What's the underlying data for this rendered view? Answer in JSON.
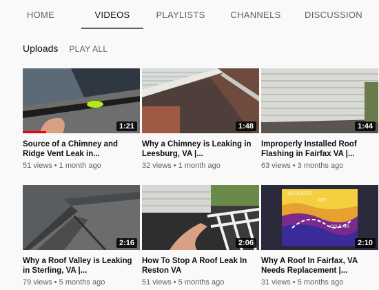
{
  "tabs": [
    {
      "label": "HOME",
      "active": false
    },
    {
      "label": "VIDEOS",
      "active": true
    },
    {
      "label": "PLAYLISTS",
      "active": false
    },
    {
      "label": "CHANNELS",
      "active": false
    },
    {
      "label": "DISCUSSION",
      "active": false
    }
  ],
  "section": {
    "title": "Uploads",
    "play_all": "PLAY ALL"
  },
  "videos": [
    {
      "title_line1": "Source of a Chimney and",
      "title_line2": "Ridge Vent Leak in...",
      "duration": "1:21",
      "views": "51 views",
      "age": "1 month ago",
      "watched_fraction": 0.2
    },
    {
      "title_line1": "Why a Chimney is Leaking in",
      "title_line2": "Leesburg, VA |...",
      "duration": "1:48",
      "views": "32 views",
      "age": "1 month ago"
    },
    {
      "title_line1": "Improperly Installed Roof",
      "title_line2": "Flashing in Fairfax VA |...",
      "duration": "1:44",
      "views": "63 views",
      "age": "3 months ago"
    },
    {
      "title_line1": "Why a Roof Valley is Leaking",
      "title_line2": "in Sterling, VA |...",
      "duration": "2:16",
      "views": "79 views",
      "age": "5 months ago"
    },
    {
      "title_line1": "How To Stop A Roof Leak In",
      "title_line2": "Reston VA",
      "duration": "2:06",
      "views": "51 views",
      "age": "5 months ago"
    },
    {
      "title_line1": "Why A Roof In Fairfax, VA",
      "title_line2": "Needs Replacement |...",
      "duration": "2:10",
      "views": "31 views",
      "age": "5 months ago"
    }
  ],
  "thermal_labels": {
    "saturated": "SATURATED",
    "wet": "WET",
    "cold_air": "COLD AIR"
  },
  "separator": "•",
  "colors": {
    "progress": "#ee0000",
    "tab_underline": "#606060"
  }
}
